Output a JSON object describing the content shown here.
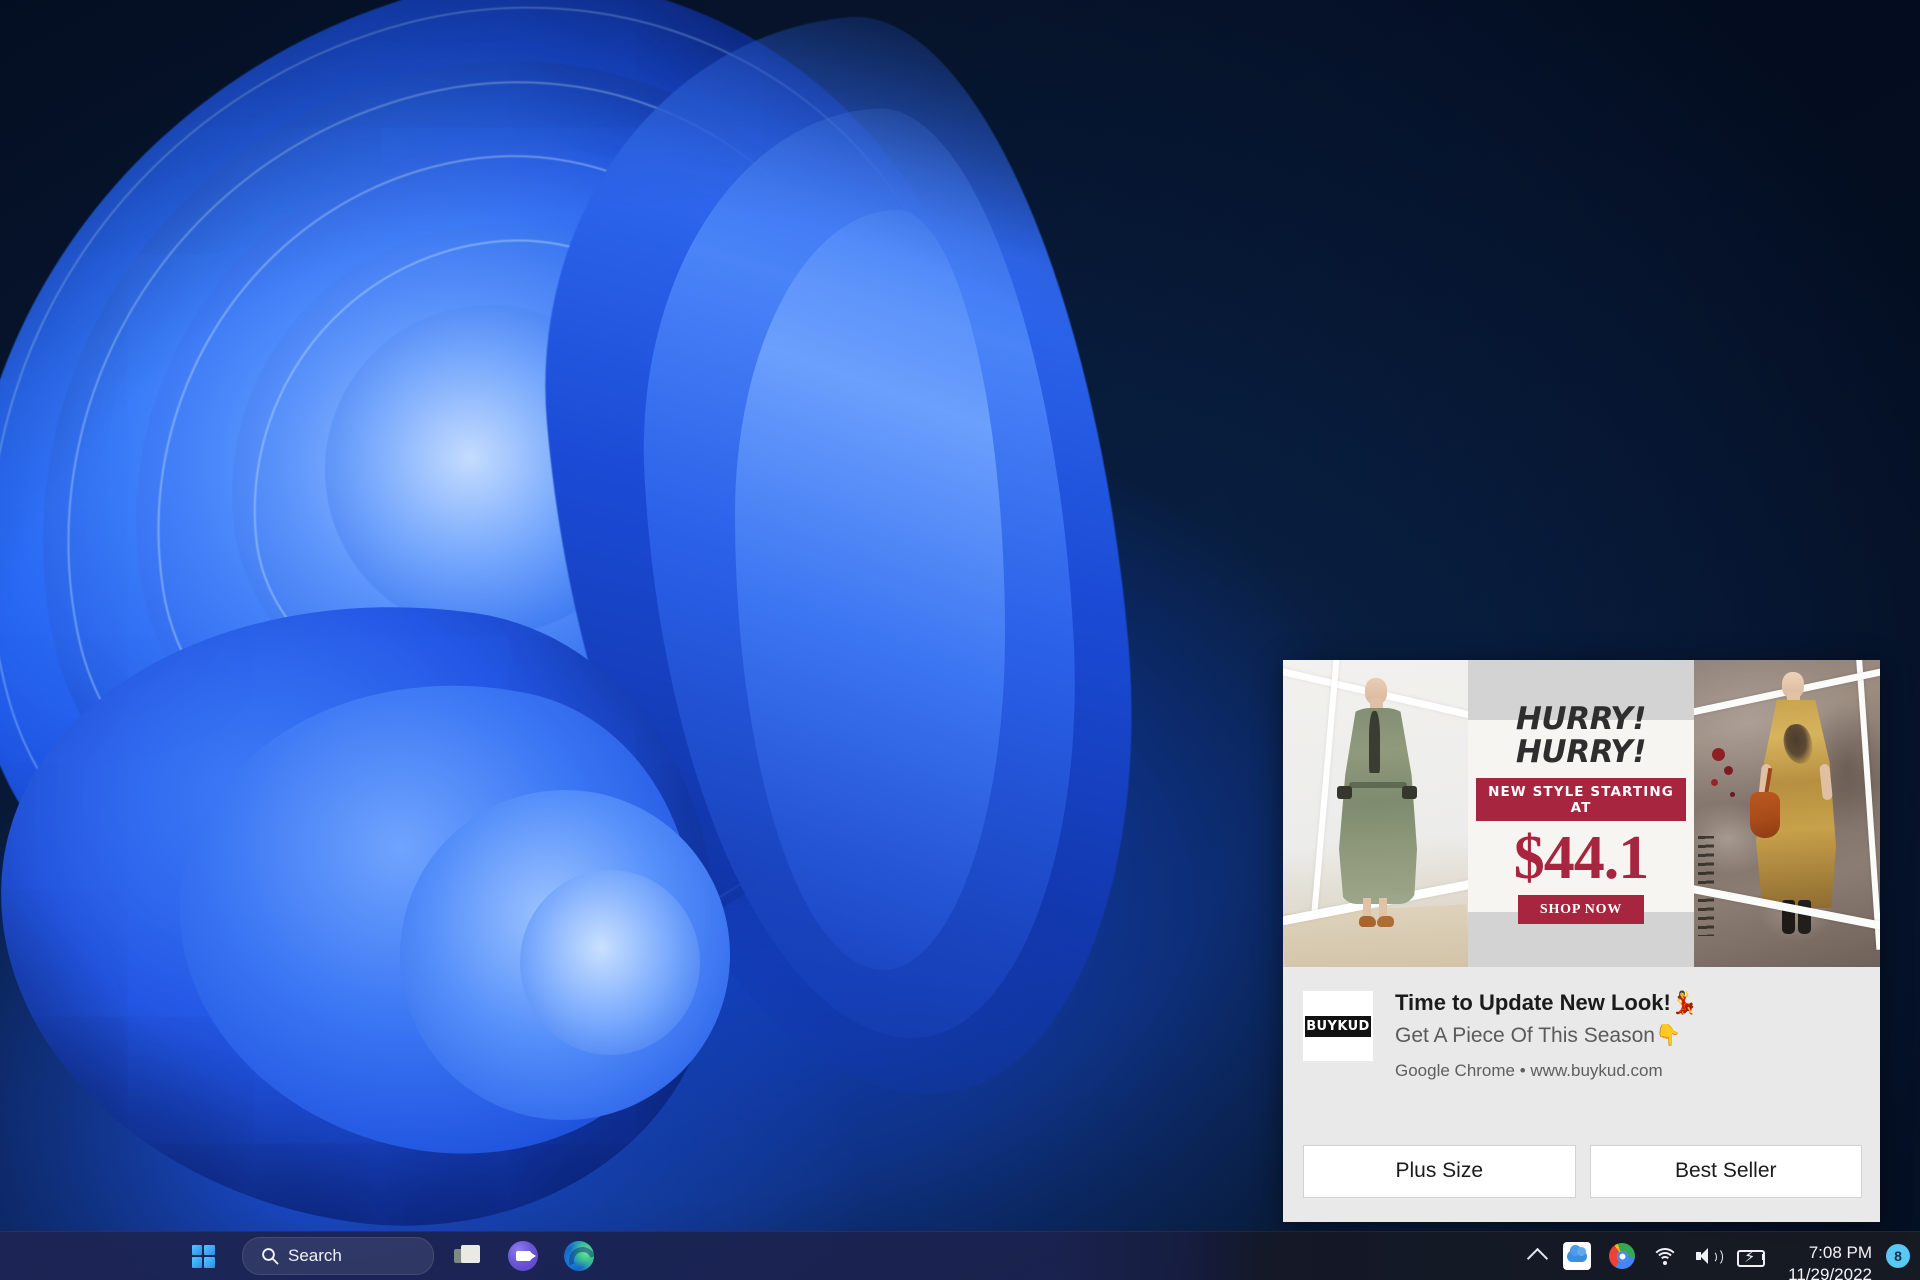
{
  "desktop": {
    "wallpaper_name": "windows-11-bloom",
    "background_color": "#06142c",
    "accent_blue": "#1b4fd8"
  },
  "notification": {
    "hero": {
      "headline": "HURRY!\nHURRY!",
      "tagline": "NEW STYLE STARTING AT",
      "price": "$44.1",
      "cta": "SHOP NOW",
      "accent_color": "#a8253f",
      "left_image_alt": "green-dress-model",
      "right_image_alt": "gold-dress-model"
    },
    "app_logo_text": "BUYKUD",
    "title": "Time to Update New Look!",
    "title_emoji": "💃",
    "subtitle": "Get A Piece Of This Season",
    "subtitle_emoji": "👇",
    "source": "Google Chrome • www.buykud.com",
    "actions": [
      {
        "label": "Plus Size"
      },
      {
        "label": "Best Seller"
      }
    ]
  },
  "taskbar": {
    "start_label": "Start",
    "search": {
      "label": "Search",
      "placeholder": "Search"
    },
    "items": [
      {
        "name": "task-view",
        "label": "Task View"
      },
      {
        "name": "teams",
        "label": "Chat"
      },
      {
        "name": "edge",
        "label": "Microsoft Edge"
      }
    ],
    "tray": {
      "overflow_label": "Show hidden icons",
      "icons": [
        {
          "name": "onedrive",
          "label": "OneDrive"
        },
        {
          "name": "chrome",
          "label": "Google Chrome"
        },
        {
          "name": "wifi",
          "label": "Network"
        },
        {
          "name": "volume",
          "label": "Volume"
        },
        {
          "name": "battery",
          "label": "Battery charging"
        }
      ],
      "time": "7:08 PM",
      "date": "11/29/2022",
      "notification_count": "8"
    }
  }
}
